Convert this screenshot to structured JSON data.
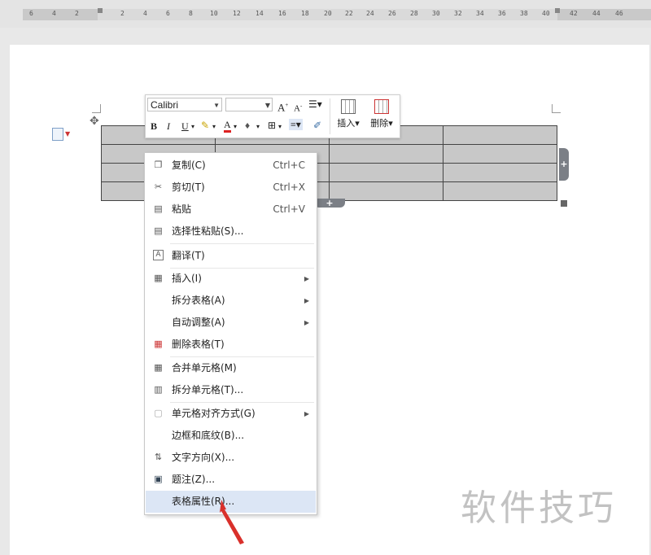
{
  "ruler": {
    "ticks": [
      "6",
      "4",
      "2",
      "2",
      "4",
      "6",
      "8",
      "10",
      "12",
      "14",
      "16",
      "18",
      "20",
      "22",
      "24",
      "26",
      "28",
      "30",
      "32",
      "34",
      "36",
      "38",
      "40",
      "42",
      "44",
      "46"
    ]
  },
  "mini_toolbar": {
    "font_name": "Calibri",
    "font_size": "",
    "grow_font": "A",
    "shrink_font": "A",
    "line_spacing_icon": "line-spacing-icon",
    "bold": "B",
    "italic": "I",
    "underline": "U",
    "font_color": "A",
    "insert_label": "插入",
    "delete_label": "删除"
  },
  "context_menu": {
    "items": [
      {
        "label": "复制(C)",
        "shortcut": "Ctrl+C",
        "icon": "copy-icon"
      },
      {
        "label": "剪切(T)",
        "shortcut": "Ctrl+X",
        "icon": "scissors-icon"
      },
      {
        "label": "粘贴",
        "shortcut": "Ctrl+V",
        "icon": "paste-icon"
      },
      {
        "label": "选择性粘贴(S)...",
        "shortcut": "",
        "icon": "paste-special-icon"
      },
      {
        "label": "翻译(T)",
        "shortcut": "",
        "icon": "translate-icon"
      },
      {
        "label": "插入(I)",
        "shortcut": "",
        "icon": "insert-icon",
        "submenu": true
      },
      {
        "label": "拆分表格(A)",
        "shortcut": "",
        "icon": "",
        "submenu": true
      },
      {
        "label": "自动调整(A)",
        "shortcut": "",
        "icon": "",
        "submenu": true
      },
      {
        "label": "删除表格(T)",
        "shortcut": "",
        "icon": "delete-table-icon"
      },
      {
        "label": "合并单元格(M)",
        "shortcut": "",
        "icon": "merge-cells-icon"
      },
      {
        "label": "拆分单元格(T)...",
        "shortcut": "",
        "icon": "split-cells-icon"
      },
      {
        "label": "单元格对齐方式(G)",
        "shortcut": "",
        "icon": "cell-align-icon",
        "submenu": true
      },
      {
        "label": "边框和底纹(B)...",
        "shortcut": "",
        "icon": ""
      },
      {
        "label": "文字方向(X)...",
        "shortcut": "",
        "icon": "text-direction-icon"
      },
      {
        "label": "题注(Z)...",
        "shortcut": "",
        "icon": "caption-icon"
      },
      {
        "label": "表格属性(R)...",
        "shortcut": "",
        "icon": "",
        "highlighted": true
      }
    ]
  },
  "watermark": "软件技巧",
  "colors": {
    "highlight": "#dce6f5",
    "table_fill": "#c8c8c8",
    "pointer_arrow": "#d9302b"
  }
}
